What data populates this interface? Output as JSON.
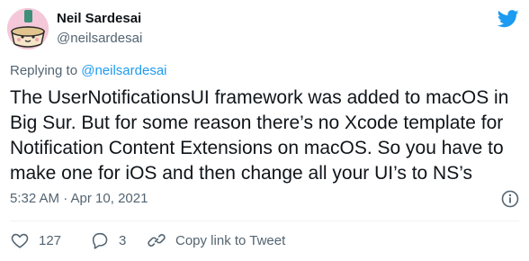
{
  "author": {
    "name": "Neil Sardesai",
    "handle": "@neilsardesai",
    "avatar_icon": "cartoon-avatar"
  },
  "reply": {
    "prefix": "Replying to",
    "handle": "@neilsardesai"
  },
  "tweet": {
    "text_lines": [
      "The UserNotificationsUI framework was added to macOS in",
      "Big Sur. But for some reason there’s no Xcode template for",
      "Notification Content Extensions on macOS. So you have to",
      "make one for iOS and then change all your UI’s to NS’s"
    ],
    "timestamp": "5:32 AM · Apr 10, 2021"
  },
  "actions": {
    "likes": "127",
    "replies": "3",
    "copy_link": "Copy link to Tweet"
  },
  "icons": {
    "brand": "twitter-bird-icon",
    "info": "info-icon",
    "like": "heart-icon",
    "reply": "reply-icon",
    "copy": "link-icon"
  },
  "colors": {
    "brand": "#1d9bf0",
    "text": "#0f1419",
    "muted": "#536471"
  }
}
